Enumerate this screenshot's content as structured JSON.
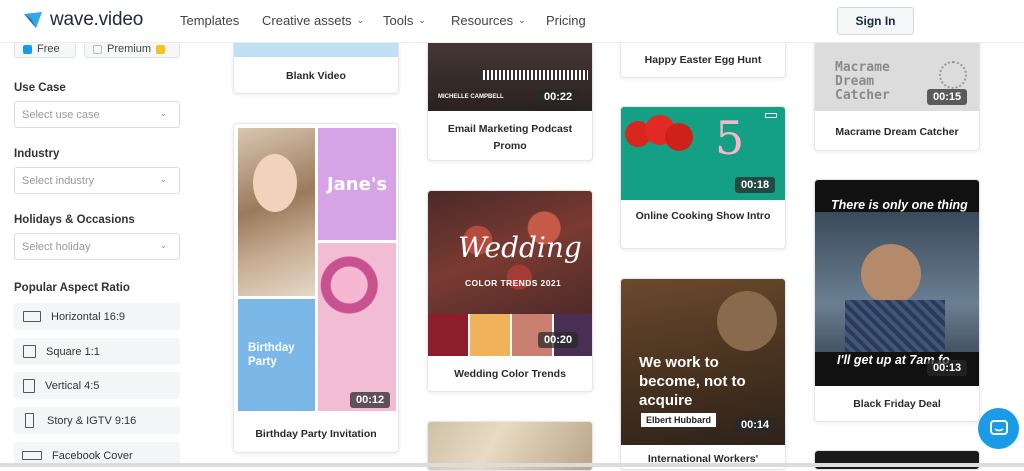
{
  "header": {
    "brand": "wave.video",
    "nav": [
      {
        "label": "Templates",
        "has_dropdown": false
      },
      {
        "label": "Creative assets",
        "has_dropdown": true
      },
      {
        "label": "Tools",
        "has_dropdown": true
      },
      {
        "label": "Resources",
        "has_dropdown": true
      },
      {
        "label": "Pricing",
        "has_dropdown": false
      }
    ],
    "signin_label": "Sign In"
  },
  "sidebar": {
    "chips": {
      "free": "Free",
      "premium": "Premium"
    },
    "use_case": {
      "label": "Use Case",
      "placeholder": "Select use case"
    },
    "industry": {
      "label": "Industry",
      "placeholder": "Select industry"
    },
    "holidays": {
      "label": "Holidays & Occasions",
      "placeholder": "Select holiday"
    },
    "aspect": {
      "label": "Popular Aspect Ratio",
      "items": [
        "Horizontal 16:9",
        "Square 1:1",
        "Vertical 4:5",
        "Story & IGTV 9:16",
        "Facebook Cover"
      ]
    }
  },
  "templates": {
    "blank": {
      "title": "Blank Video"
    },
    "birthday": {
      "title": "Birthday Party Invitation",
      "duration": "00:12",
      "overlay_name": "Jane's",
      "overlay_party": "Birthday Party"
    },
    "podcast": {
      "title": "Email Marketing Podcast Promo",
      "duration": "00:22",
      "overlay": "MICHELLE CAMPBELL"
    },
    "wedding": {
      "title": "Wedding Color Trends",
      "duration": "00:20",
      "overlay_title": "Wedding",
      "overlay_sub": "COLOR TRENDS 2021"
    },
    "easter": {
      "title": "Happy Easter Egg Hunt"
    },
    "cooking": {
      "title": "Online Cooking Show Intro",
      "duration": "00:18",
      "overlay_number": "5"
    },
    "workers": {
      "title": "International Workers'",
      "duration": "00:14",
      "overlay_quote": "We work to become, not to acquire",
      "overlay_author": "Elbert Hubbard"
    },
    "macrame": {
      "title": "Macrame Dream Catcher",
      "duration": "00:15",
      "overlay": "Macrame Dream Catcher"
    },
    "blackfriday": {
      "title": "Black Friday Deal",
      "duration": "00:13",
      "overlay_top": "There is only one thing",
      "overlay_bottom": "I'll get up at 7am fo"
    }
  },
  "colors": {
    "accent": "#1a9be6",
    "wedding_swatches": [
      "#8e1d2b",
      "#f0b25a",
      "#c98070",
      "#4a2f55"
    ]
  }
}
